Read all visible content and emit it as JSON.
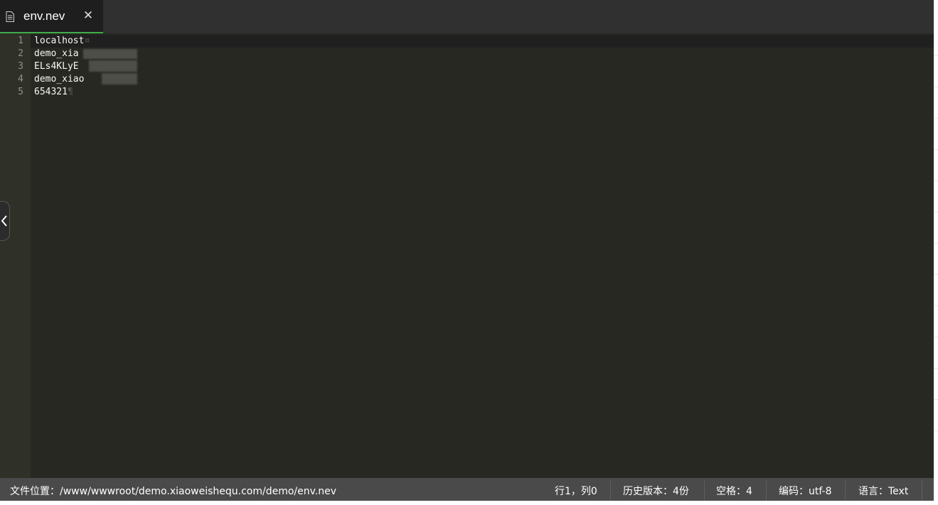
{
  "tab": {
    "title": "env.nev",
    "close_glyph": "✕",
    "icon": "file-icon"
  },
  "editor": {
    "lines": [
      {
        "number": "1",
        "text": "localhost",
        "eol": "¤"
      },
      {
        "number": "2",
        "text": "demo_xia",
        "eol": ""
      },
      {
        "number": "3",
        "text": "ELs4KLyE",
        "eol": ""
      },
      {
        "number": "4",
        "text": "demo_xiao",
        "eol": ""
      },
      {
        "number": "5",
        "text": "654321",
        "eol": "¶"
      }
    ]
  },
  "statusbar": {
    "file_path": "文件位置：/www/wwwroot/demo.xiaoweishequ.com/demo/env.nev",
    "cursor": "行1，列0",
    "history": "历史版本：4份",
    "indent": "空格：4",
    "encoding": "编码：utf-8",
    "language": "语言：Text"
  },
  "colors": {
    "editor_bg": "#272822",
    "tab_active_bg": "#1e1e1e",
    "tab_underline": "#3fae4b",
    "statusbar_bg": "#4a4a4a"
  }
}
